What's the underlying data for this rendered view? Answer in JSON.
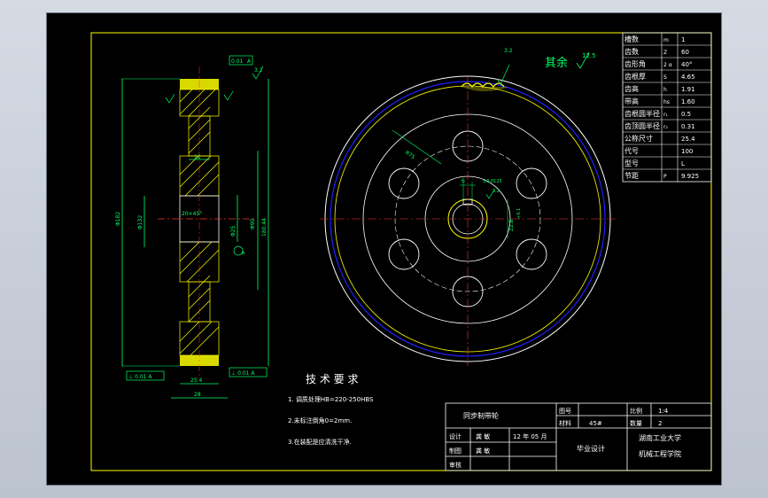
{
  "colors": {
    "background": "#000000",
    "frame": "#ffff00",
    "outline": "#ffffff",
    "gear_blue": "#2020ff",
    "dimension": "#00ff66",
    "hatch": "#ffff00",
    "centerline": "#ff3333",
    "body": "#ffffff"
  },
  "annotations": {
    "roughness_rest": "其余",
    "roughness_rest_value": "12.5",
    "roughness_teeth": "3.2",
    "roughness_side": "3.2",
    "roughness_bore": "3.2",
    "radius_label": "R75",
    "dim_keyway_width": "6",
    "dim_keyway_tol": "±0.0125",
    "dim_keyway_depth": "22.8",
    "dim_keyway_depth_tol": "+0.1",
    "side_flat_tol": "0.01",
    "side_flat_ref": "A",
    "side_outer_dia": "Φ182",
    "side_dia_132": "Φ132",
    "side_dia_90": "Φ90",
    "side_dia_outer_right": "180.44",
    "side_bore_dia": "Φ25",
    "side_bore_tol": "H7",
    "side_web": "12",
    "side_hub": "25.4",
    "side_width": "28",
    "side_chamfer": "20×45°",
    "perp_tol_left": "⊥ 0.01 A",
    "perp_tol_right": "⊥ 0.01 A",
    "ref_a": "A"
  },
  "params": {
    "rows": [
      {
        "name": "槽数",
        "sym": "m",
        "val": "1"
      },
      {
        "name": "齿数",
        "sym": "Z",
        "val": "60"
      },
      {
        "name": "齿形角",
        "sym": "2 α",
        "val": "40°"
      },
      {
        "name": "齿根厚",
        "sym": "S",
        "val": "4.65"
      },
      {
        "name": "齿高",
        "sym": "h",
        "val": "1.91"
      },
      {
        "name": "带高",
        "sym": "hs",
        "val": "1.60"
      },
      {
        "name": "齿根圆半径",
        "sym": "r₁",
        "val": "0.5"
      },
      {
        "name": "齿顶圆半径",
        "sym": "r₂",
        "val": "0.31"
      },
      {
        "name": "公称尺寸",
        "sym": "",
        "val": "25.4"
      },
      {
        "name": "代号",
        "sym": "",
        "val": "100"
      },
      {
        "name": "型号",
        "sym": "",
        "val": "L"
      },
      {
        "name": "节距",
        "sym": "P",
        "val": "9.925"
      }
    ]
  },
  "tech_req": {
    "title": "技 术 要 求",
    "items": [
      "1. 调质处理HB=220-250HBS",
      "2.未标注倒角0=2mm.",
      "3.在装配是应清洗干净."
    ]
  },
  "title_block": {
    "part_name": "同步制带轮",
    "label_drawing_no": "图号",
    "label_material": "材料",
    "material": "45#",
    "label_scale": "比例",
    "scale": "1:4",
    "label_qty": "数量",
    "qty": "2",
    "label_design": "设计",
    "designer": "龚 敏",
    "date": "12 年 05 月",
    "label_draw": "制图",
    "drawer": "龚 敏",
    "label_review": "审核",
    "project": "毕业设计",
    "school": "湖南工业大学",
    "dept": "机械工程学院"
  }
}
